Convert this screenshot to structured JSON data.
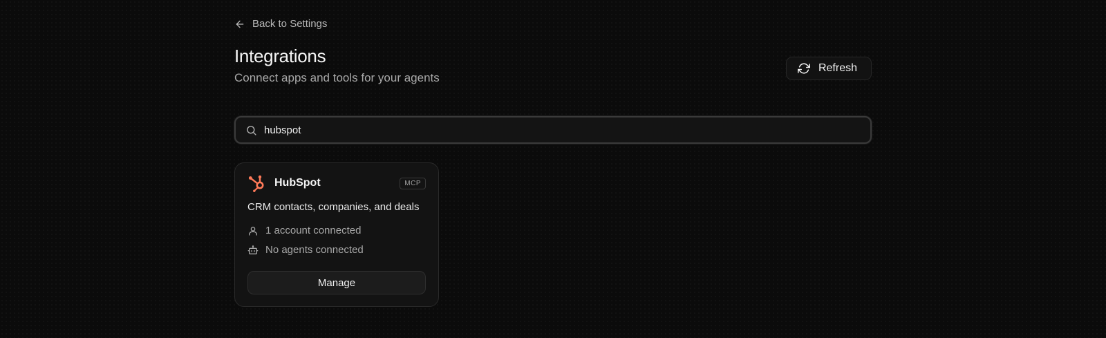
{
  "nav": {
    "back_label": "Back to Settings"
  },
  "header": {
    "title": "Integrations",
    "subtitle": "Connect apps and tools for your agents",
    "refresh_label": "Refresh"
  },
  "search": {
    "value": "hubspot"
  },
  "integrations": [
    {
      "name": "HubSpot",
      "badge": "MCP",
      "description": "CRM contacts, companies, and deals",
      "accounts": "1 account connected",
      "agents": "No agents connected",
      "action_label": "Manage",
      "brand_color": "#ff7a59"
    }
  ],
  "icons": {
    "back": "arrow-left-icon",
    "refresh": "refresh-icon",
    "search": "search-icon",
    "logo": "hubspot-logo-icon",
    "accounts": "user-icon",
    "agents": "bot-icon"
  },
  "colors": {
    "background": "#0b0b0b",
    "card": "#131313",
    "text": "#f2f2f2",
    "muted": "#a8a8a8"
  }
}
